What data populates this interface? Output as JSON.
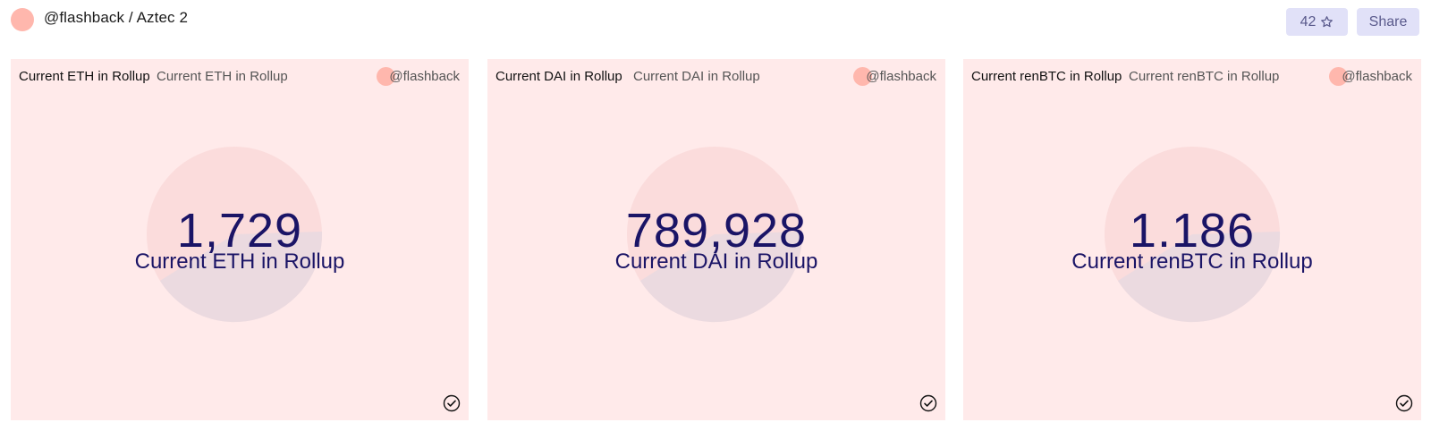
{
  "header": {
    "title": "@flashback / Aztec 2",
    "star_count": "42",
    "share_label": "Share"
  },
  "cards": [
    {
      "title": "Current ETH in Rollup",
      "subtitle": "Current ETH in Rollup",
      "author": "@flashback",
      "value": "1,729",
      "value_label": "Current ETH in Rollup"
    },
    {
      "title": "Current DAI in Rollup",
      "subtitle": "Current DAI in Rollup",
      "author": "@flashback",
      "value": "789,928",
      "value_label": "Current DAI in Rollup"
    },
    {
      "title": "Current renBTC in Rollup",
      "subtitle": "Current renBTC in Rollup",
      "author": "@flashback",
      "value": "1.186",
      "value_label": "Current renBTC in Rollup"
    }
  ],
  "colors": {
    "card_background": "#ffeaea",
    "avatar": "#ffb7ad",
    "value_text": "#1a1466",
    "button_background": "#e1e1f8"
  }
}
